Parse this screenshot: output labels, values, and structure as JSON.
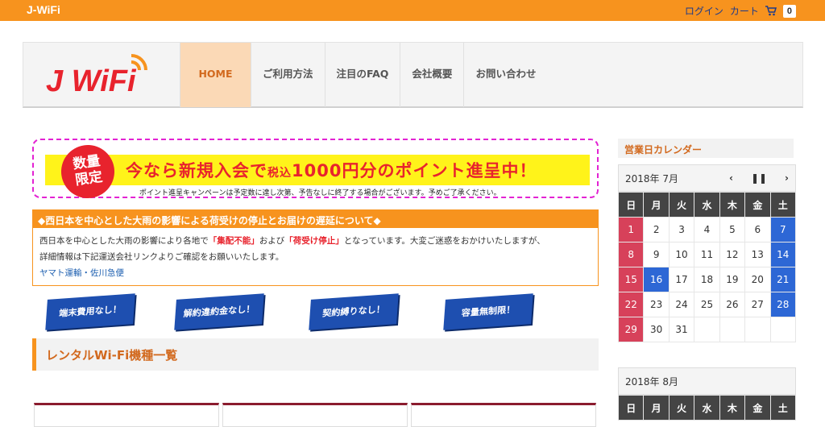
{
  "topbar": {
    "brand": "J-WiFi",
    "login": "ログイン",
    "cart": "カート",
    "cart_count": "0"
  },
  "nav": {
    "items": [
      "HOME",
      "ご利用方法",
      "注目のFAQ",
      "会社概要",
      "お問い合わせ"
    ]
  },
  "logo": {
    "text": "J WiFi"
  },
  "promo": {
    "badge_line1": "数量",
    "badge_line2": "限定",
    "main_a": "今なら新規入会で",
    "main_small": "税込",
    "main_b": "1000円分のポイント進呈中！",
    "note": "ポイント進呈キャンペーンは予定数に達し次第、予告なしに終了する場合がございます。予めご了承ください。"
  },
  "notice": {
    "heading": "◆西日本を中心とした大雨の影響による荷受けの停止とお届けの遅延について◆",
    "line1_a": "西日本を中心とした大雨の影響により各地で",
    "line1_red1": "「集配不能」",
    "line1_b": "および",
    "line1_red2": "「荷受け停止」",
    "line1_c": "となっています。大変ご迷惑をおかけいたしますが、",
    "line2": "詳細情報は下記運送会社リンクよりご確認をお願いいたします。",
    "links": "ヤマト運輸・佐川急便"
  },
  "tags": [
    "端末費用なし！",
    "解約違約金なし！",
    "契約縛りなし！",
    "容量無制限！"
  ],
  "section_title": "レンタルWi-Fi機種一覧",
  "sidebar": {
    "title": "営業日カレンダー",
    "cal1": {
      "month": "2018年 7月",
      "weekdays": [
        "日",
        "月",
        "火",
        "水",
        "木",
        "金",
        "土"
      ],
      "weeks": [
        [
          "1",
          "2",
          "3",
          "4",
          "5",
          "6",
          "7"
        ],
        [
          "8",
          "9",
          "10",
          "11",
          "12",
          "13",
          "14"
        ],
        [
          "15",
          "16",
          "17",
          "18",
          "19",
          "20",
          "21"
        ],
        [
          "22",
          "23",
          "24",
          "25",
          "26",
          "27",
          "28"
        ],
        [
          "29",
          "30",
          "31",
          "",
          "",
          "",
          ""
        ]
      ],
      "holidays": [
        "1",
        "7",
        "8",
        "14",
        "15",
        "16",
        "21",
        "22",
        "28",
        "29"
      ],
      "holiday_blue": [
        "7",
        "14",
        "16",
        "21",
        "28"
      ]
    },
    "cal2": {
      "month": "2018年 8月",
      "weekdays": [
        "日",
        "月",
        "火",
        "水",
        "木",
        "金",
        "土"
      ]
    }
  },
  "colors": {
    "orange": "#f7931e",
    "red": "#e8232d",
    "blue": "#2d67d5",
    "holiday_red": "#d7415a"
  }
}
